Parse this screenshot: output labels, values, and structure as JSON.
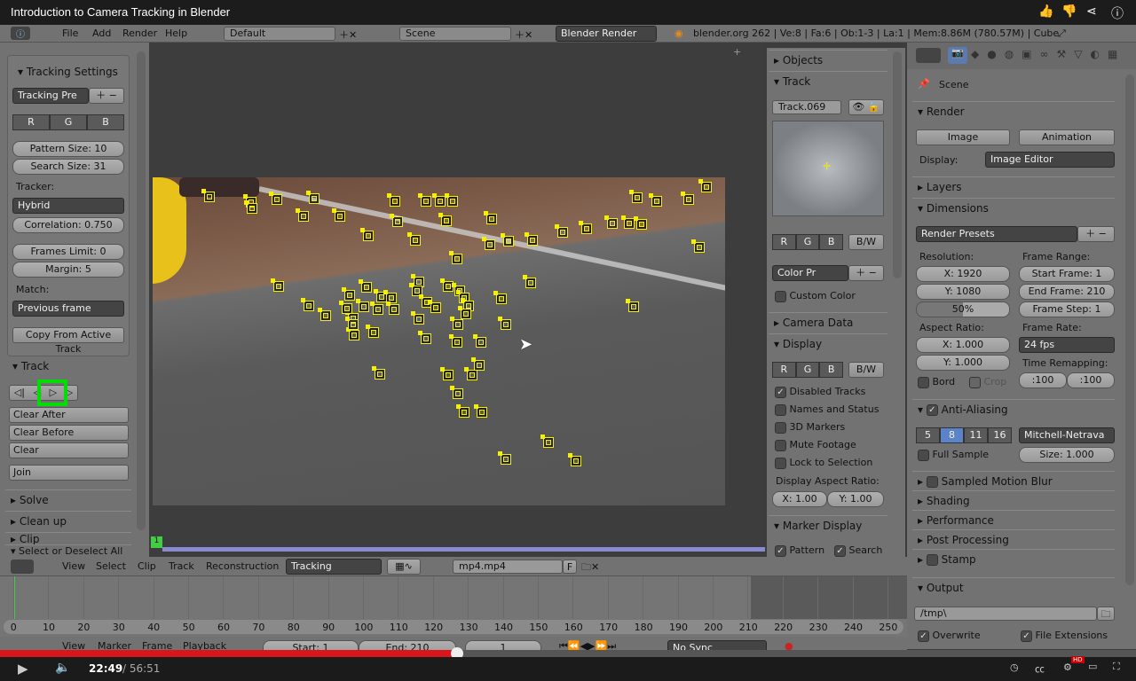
{
  "video": {
    "title": "Introduction to Camera Tracking in Blender",
    "current_time": "22:49",
    "total_time": "/ 56:51",
    "progress_percent": 40.2,
    "hd_badge": "HD"
  },
  "info_header": {
    "menus": [
      "File",
      "Add",
      "Render",
      "Help"
    ],
    "screen": "Default",
    "scene": "Scene",
    "engine": "Blender Render",
    "stats": "blender.org 262 | Ve:8 | Fa:6 | Ob:1-3 | La:1 | Mem:8.86M (780.57M) | Cube"
  },
  "toolshelf": {
    "tracking_settings": {
      "title": "Tracking Settings",
      "preset": "Tracking Pre",
      "channels": [
        "R",
        "G",
        "B"
      ],
      "pattern_size": "Pattern Size: 10",
      "search_size": "Search Size: 31",
      "tracker_label": "Tracker:",
      "tracker": "Hybrid",
      "correlation": "Correlation: 0.750",
      "frames_limit": "Frames Limit: 0",
      "margin": "Margin: 5",
      "match_label": "Match:",
      "match": "Previous frame",
      "copy_button": "Copy From Active Track"
    },
    "track": {
      "title": "Track",
      "clear_after": "Clear After",
      "clear_before": "Clear Before",
      "clear": "Clear",
      "join": "Join"
    },
    "collapsed": [
      "Solve",
      "Clean up",
      "Clip",
      "Select or Deselect All"
    ]
  },
  "clip_view": {
    "frame_indicator": "1",
    "highlight_color": "#00dd00",
    "marker_color": "#f4f000"
  },
  "clip_properties": {
    "objects": "Objects",
    "track_title": "Track",
    "track_name": "Track.069",
    "channels": [
      "R",
      "G",
      "B"
    ],
    "bw": "B/W",
    "color_preset": "Color Pr",
    "custom_color": "Custom Color",
    "camera_data": "Camera Data",
    "display": "Display",
    "display_options": [
      {
        "label": "Disabled Tracks",
        "checked": true
      },
      {
        "label": "Names and Status",
        "checked": false
      },
      {
        "label": "3D Markers",
        "checked": false
      },
      {
        "label": "Mute Footage",
        "checked": false
      },
      {
        "label": "Lock to Selection",
        "checked": false
      }
    ],
    "aspect_label": "Display Aspect Ratio:",
    "aspect_x": "X: 1.00",
    "aspect_y": "Y: 1.00",
    "marker_display": "Marker Display",
    "pattern": "Pattern",
    "search": "Search"
  },
  "properties": {
    "context": "Scene",
    "render": "Render",
    "image": "Image",
    "animation": "Animation",
    "display_label": "Display:",
    "display": "Image Editor",
    "layers": "Layers",
    "dimensions": "Dimensions",
    "presets": "Render Presets",
    "resolution_label": "Resolution:",
    "res_x": "X: 1920",
    "res_y": "Y: 1080",
    "res_pct": "50%",
    "frame_range_label": "Frame Range:",
    "start": "Start Frame: 1",
    "end": "End Frame: 210",
    "step": "Frame Step: 1",
    "aspect_label": "Aspect Ratio:",
    "asp_x": "X: 1.000",
    "asp_y": "Y: 1.000",
    "frame_rate_label": "Frame Rate:",
    "fps": "24 fps",
    "remap_label": "Time Remapping:",
    "remap_old": ":100",
    "remap_new": ":100",
    "bord": "Bord",
    "crop": "Crop",
    "aa": "Anti-Aliasing",
    "aa_samples": [
      "5",
      "8",
      "11",
      "16"
    ],
    "aa_selected": "8",
    "filter": "Mitchell-Netrava",
    "full_sample": "Full Sample",
    "size": "Size: 1.000",
    "collapsed": [
      "Sampled Motion Blur",
      "Shading",
      "Performance",
      "Post Processing",
      "Stamp"
    ],
    "output": "Output",
    "path": "/tmp\\",
    "overwrite": "Overwrite",
    "file_ext": "File Extensions"
  },
  "clip_header": {
    "menus": [
      "View",
      "Select",
      "Clip",
      "Track",
      "Reconstruction"
    ],
    "mode": "Tracking",
    "clip": "mp4.mp4",
    "fake": "F"
  },
  "timeline": {
    "ticks": [
      "0",
      "10",
      "20",
      "30",
      "40",
      "50",
      "60",
      "70",
      "80",
      "90",
      "100",
      "110",
      "120",
      "130",
      "140",
      "150",
      "160",
      "170",
      "180",
      "190",
      "200",
      "210",
      "220",
      "230",
      "240",
      "250"
    ],
    "menus": [
      "View",
      "Marker",
      "Frame",
      "Playback"
    ],
    "start": "Start: 1",
    "end": "End: 210",
    "current": "1",
    "sync": "No Sync"
  }
}
